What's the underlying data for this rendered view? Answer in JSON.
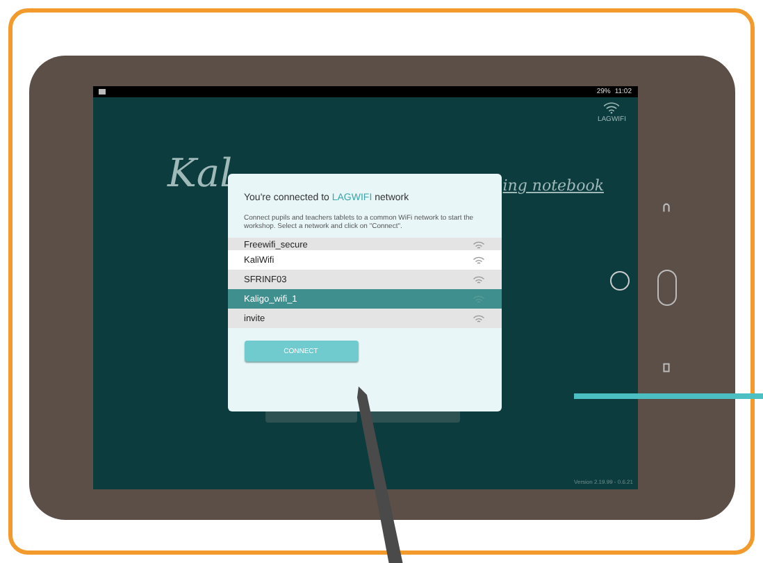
{
  "status_bar": {
    "battery": "29%",
    "time": "11:02"
  },
  "wifi_indicator": {
    "label": "LAGWIFI"
  },
  "background_title": {
    "left": "Kal",
    "right": "ing notebook"
  },
  "dialog": {
    "title_prefix": "You're connected to",
    "network_name": "LAGWIFI",
    "title_suffix": "network",
    "message": "Connect pupils and teachers tablets to a common WiFi network to start the workshop. Select a network and click on \"Connect\".",
    "networks": [
      {
        "name": "Freewifi_secure",
        "selected": false
      },
      {
        "name": "KaliWifi",
        "selected": false
      },
      {
        "name": "SFRINF03",
        "selected": false
      },
      {
        "name": "Kaligo_wifi_1",
        "selected": true
      },
      {
        "name": "invite",
        "selected": false
      }
    ],
    "button": "CONNECT"
  },
  "version": "Version 2.19.99 - 0.6.21"
}
